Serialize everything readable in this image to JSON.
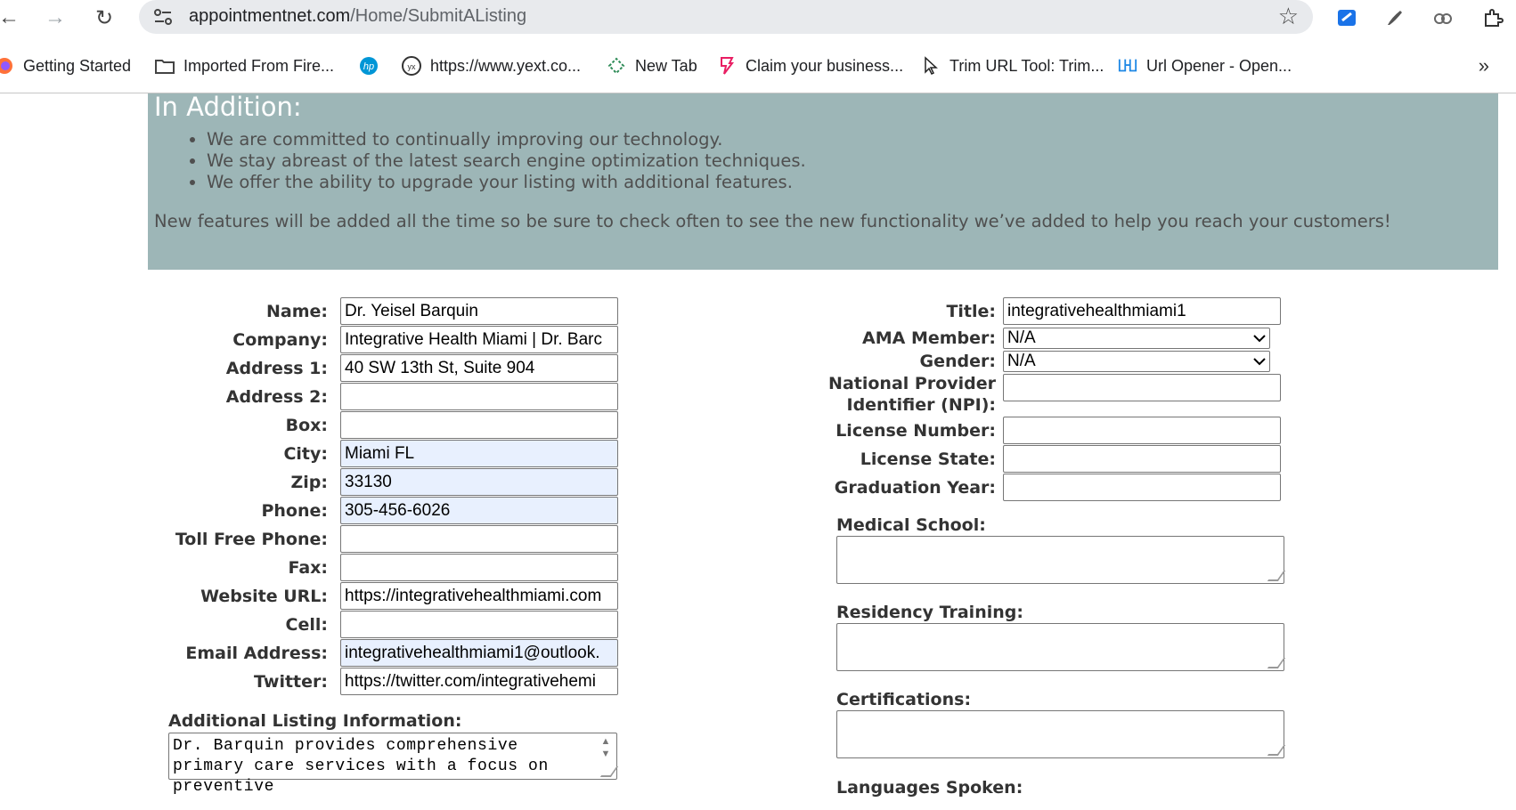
{
  "browser": {
    "url_host": "appointmentnet.com",
    "url_path": "/Home/SubmitAListing",
    "bookmarks": [
      {
        "label": "Getting Started",
        "icon": "firefox-icon"
      },
      {
        "label": "Imported From Fire...",
        "icon": "folder-icon"
      },
      {
        "label": "",
        "icon": "hp-icon"
      },
      {
        "label": "https://www.yext.co...",
        "icon": "yext-icon"
      },
      {
        "label": "New Tab",
        "icon": "newtab-icon"
      },
      {
        "label": "Claim your business...",
        "icon": "claim-icon"
      },
      {
        "label": "Trim URL Tool: Trim...",
        "icon": "cursor-icon"
      },
      {
        "label": "Url Opener - Open...",
        "icon": "url-opener-icon"
      }
    ],
    "more_label": "»"
  },
  "banner": {
    "heading": "In Addition:",
    "bullets": [
      "We are committed to continually improving our technology.",
      "We stay abreast of the latest search engine optimization techniques.",
      "We offer the ability to upgrade your listing with additional features."
    ],
    "note": "New features will be added all the time so be sure to check often to see the new functionality we’ve added to help you reach your customers!"
  },
  "form_left": {
    "fields": [
      {
        "label": "Name:",
        "value": "Dr. Yeisel Barquin",
        "autofill": false
      },
      {
        "label": "Company:",
        "value": "Integrative Health Miami | Dr. Barc",
        "autofill": false
      },
      {
        "label": "Address 1:",
        "value": "40 SW 13th St, Suite 904",
        "autofill": false
      },
      {
        "label": "Address 2:",
        "value": "",
        "autofill": false
      },
      {
        "label": "Box:",
        "value": "",
        "autofill": false
      },
      {
        "label": "City:",
        "value": "Miami FL",
        "autofill": true
      },
      {
        "label": "Zip:",
        "value": "33130",
        "autofill": true
      },
      {
        "label": "Phone:",
        "value": "305-456-6026",
        "autofill": true
      },
      {
        "label": "Toll Free Phone:",
        "value": "",
        "autofill": false
      },
      {
        "label": "Fax:",
        "value": "",
        "autofill": false
      },
      {
        "label": "Website URL:",
        "value": "https://integrativehealthmiami.com",
        "autofill": false
      },
      {
        "label": "Cell:",
        "value": "",
        "autofill": false
      },
      {
        "label": "Email Address:",
        "value": "integrativehealthmiami1@outlook.",
        "autofill": true
      },
      {
        "label": "Twitter:",
        "value": "https://twitter.com/integrativehemi",
        "autofill": false
      }
    ],
    "additional_label": "Additional Listing Information:",
    "additional_value": "Dr. Barquin provides comprehensive primary care services with a focus on preventive"
  },
  "form_right": {
    "title_label": "Title:",
    "title_value": "integrativehealthmiami1",
    "ama_label": "AMA Member:",
    "ama_value": "N/A",
    "gender_label": "Gender:",
    "gender_value": "N/A",
    "npi_label_1": "National Provider",
    "npi_label_2": "Identifier (NPI):",
    "license_number_label": "License Number:",
    "license_state_label": "License State:",
    "graduation_year_label": "Graduation Year:",
    "medical_school_label": "Medical School:",
    "residency_label": "Residency Training:",
    "certifications_label": "Certifications:",
    "languages_label": "Languages Spoken:"
  }
}
